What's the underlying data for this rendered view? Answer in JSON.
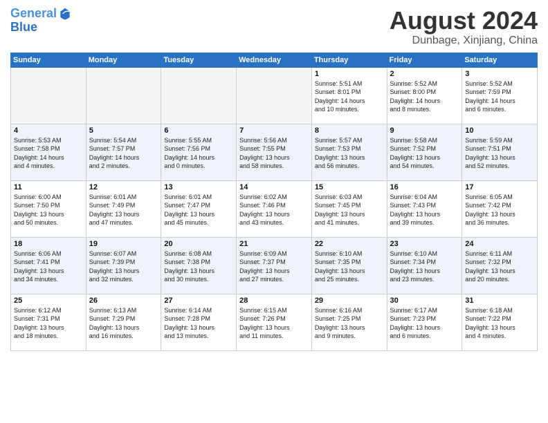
{
  "header": {
    "logo_line1": "General",
    "logo_line2": "Blue",
    "month_title": "August 2024",
    "subtitle": "Dunbage, Xinjiang, China"
  },
  "days_of_week": [
    "Sunday",
    "Monday",
    "Tuesday",
    "Wednesday",
    "Thursday",
    "Friday",
    "Saturday"
  ],
  "weeks": [
    [
      {
        "num": "",
        "info": "",
        "empty": true
      },
      {
        "num": "",
        "info": "",
        "empty": true
      },
      {
        "num": "",
        "info": "",
        "empty": true
      },
      {
        "num": "",
        "info": "",
        "empty": true
      },
      {
        "num": "1",
        "info": "Sunrise: 5:51 AM\nSunset: 8:01 PM\nDaylight: 14 hours\nand 10 minutes.",
        "empty": false
      },
      {
        "num": "2",
        "info": "Sunrise: 5:52 AM\nSunset: 8:00 PM\nDaylight: 14 hours\nand 8 minutes.",
        "empty": false
      },
      {
        "num": "3",
        "info": "Sunrise: 5:52 AM\nSunset: 7:59 PM\nDaylight: 14 hours\nand 6 minutes.",
        "empty": false
      }
    ],
    [
      {
        "num": "4",
        "info": "Sunrise: 5:53 AM\nSunset: 7:58 PM\nDaylight: 14 hours\nand 4 minutes.",
        "empty": false
      },
      {
        "num": "5",
        "info": "Sunrise: 5:54 AM\nSunset: 7:57 PM\nDaylight: 14 hours\nand 2 minutes.",
        "empty": false
      },
      {
        "num": "6",
        "info": "Sunrise: 5:55 AM\nSunset: 7:56 PM\nDaylight: 14 hours\nand 0 minutes.",
        "empty": false
      },
      {
        "num": "7",
        "info": "Sunrise: 5:56 AM\nSunset: 7:55 PM\nDaylight: 13 hours\nand 58 minutes.",
        "empty": false
      },
      {
        "num": "8",
        "info": "Sunrise: 5:57 AM\nSunset: 7:53 PM\nDaylight: 13 hours\nand 56 minutes.",
        "empty": false
      },
      {
        "num": "9",
        "info": "Sunrise: 5:58 AM\nSunset: 7:52 PM\nDaylight: 13 hours\nand 54 minutes.",
        "empty": false
      },
      {
        "num": "10",
        "info": "Sunrise: 5:59 AM\nSunset: 7:51 PM\nDaylight: 13 hours\nand 52 minutes.",
        "empty": false
      }
    ],
    [
      {
        "num": "11",
        "info": "Sunrise: 6:00 AM\nSunset: 7:50 PM\nDaylight: 13 hours\nand 50 minutes.",
        "empty": false
      },
      {
        "num": "12",
        "info": "Sunrise: 6:01 AM\nSunset: 7:49 PM\nDaylight: 13 hours\nand 47 minutes.",
        "empty": false
      },
      {
        "num": "13",
        "info": "Sunrise: 6:01 AM\nSunset: 7:47 PM\nDaylight: 13 hours\nand 45 minutes.",
        "empty": false
      },
      {
        "num": "14",
        "info": "Sunrise: 6:02 AM\nSunset: 7:46 PM\nDaylight: 13 hours\nand 43 minutes.",
        "empty": false
      },
      {
        "num": "15",
        "info": "Sunrise: 6:03 AM\nSunset: 7:45 PM\nDaylight: 13 hours\nand 41 minutes.",
        "empty": false
      },
      {
        "num": "16",
        "info": "Sunrise: 6:04 AM\nSunset: 7:43 PM\nDaylight: 13 hours\nand 39 minutes.",
        "empty": false
      },
      {
        "num": "17",
        "info": "Sunrise: 6:05 AM\nSunset: 7:42 PM\nDaylight: 13 hours\nand 36 minutes.",
        "empty": false
      }
    ],
    [
      {
        "num": "18",
        "info": "Sunrise: 6:06 AM\nSunset: 7:41 PM\nDaylight: 13 hours\nand 34 minutes.",
        "empty": false
      },
      {
        "num": "19",
        "info": "Sunrise: 6:07 AM\nSunset: 7:39 PM\nDaylight: 13 hours\nand 32 minutes.",
        "empty": false
      },
      {
        "num": "20",
        "info": "Sunrise: 6:08 AM\nSunset: 7:38 PM\nDaylight: 13 hours\nand 30 minutes.",
        "empty": false
      },
      {
        "num": "21",
        "info": "Sunrise: 6:09 AM\nSunset: 7:37 PM\nDaylight: 13 hours\nand 27 minutes.",
        "empty": false
      },
      {
        "num": "22",
        "info": "Sunrise: 6:10 AM\nSunset: 7:35 PM\nDaylight: 13 hours\nand 25 minutes.",
        "empty": false
      },
      {
        "num": "23",
        "info": "Sunrise: 6:10 AM\nSunset: 7:34 PM\nDaylight: 13 hours\nand 23 minutes.",
        "empty": false
      },
      {
        "num": "24",
        "info": "Sunrise: 6:11 AM\nSunset: 7:32 PM\nDaylight: 13 hours\nand 20 minutes.",
        "empty": false
      }
    ],
    [
      {
        "num": "25",
        "info": "Sunrise: 6:12 AM\nSunset: 7:31 PM\nDaylight: 13 hours\nand 18 minutes.",
        "empty": false
      },
      {
        "num": "26",
        "info": "Sunrise: 6:13 AM\nSunset: 7:29 PM\nDaylight: 13 hours\nand 16 minutes.",
        "empty": false
      },
      {
        "num": "27",
        "info": "Sunrise: 6:14 AM\nSunset: 7:28 PM\nDaylight: 13 hours\nand 13 minutes.",
        "empty": false
      },
      {
        "num": "28",
        "info": "Sunrise: 6:15 AM\nSunset: 7:26 PM\nDaylight: 13 hours\nand 11 minutes.",
        "empty": false
      },
      {
        "num": "29",
        "info": "Sunrise: 6:16 AM\nSunset: 7:25 PM\nDaylight: 13 hours\nand 9 minutes.",
        "empty": false
      },
      {
        "num": "30",
        "info": "Sunrise: 6:17 AM\nSunset: 7:23 PM\nDaylight: 13 hours\nand 6 minutes.",
        "empty": false
      },
      {
        "num": "31",
        "info": "Sunrise: 6:18 AM\nSunset: 7:22 PM\nDaylight: 13 hours\nand 4 minutes.",
        "empty": false
      }
    ]
  ]
}
